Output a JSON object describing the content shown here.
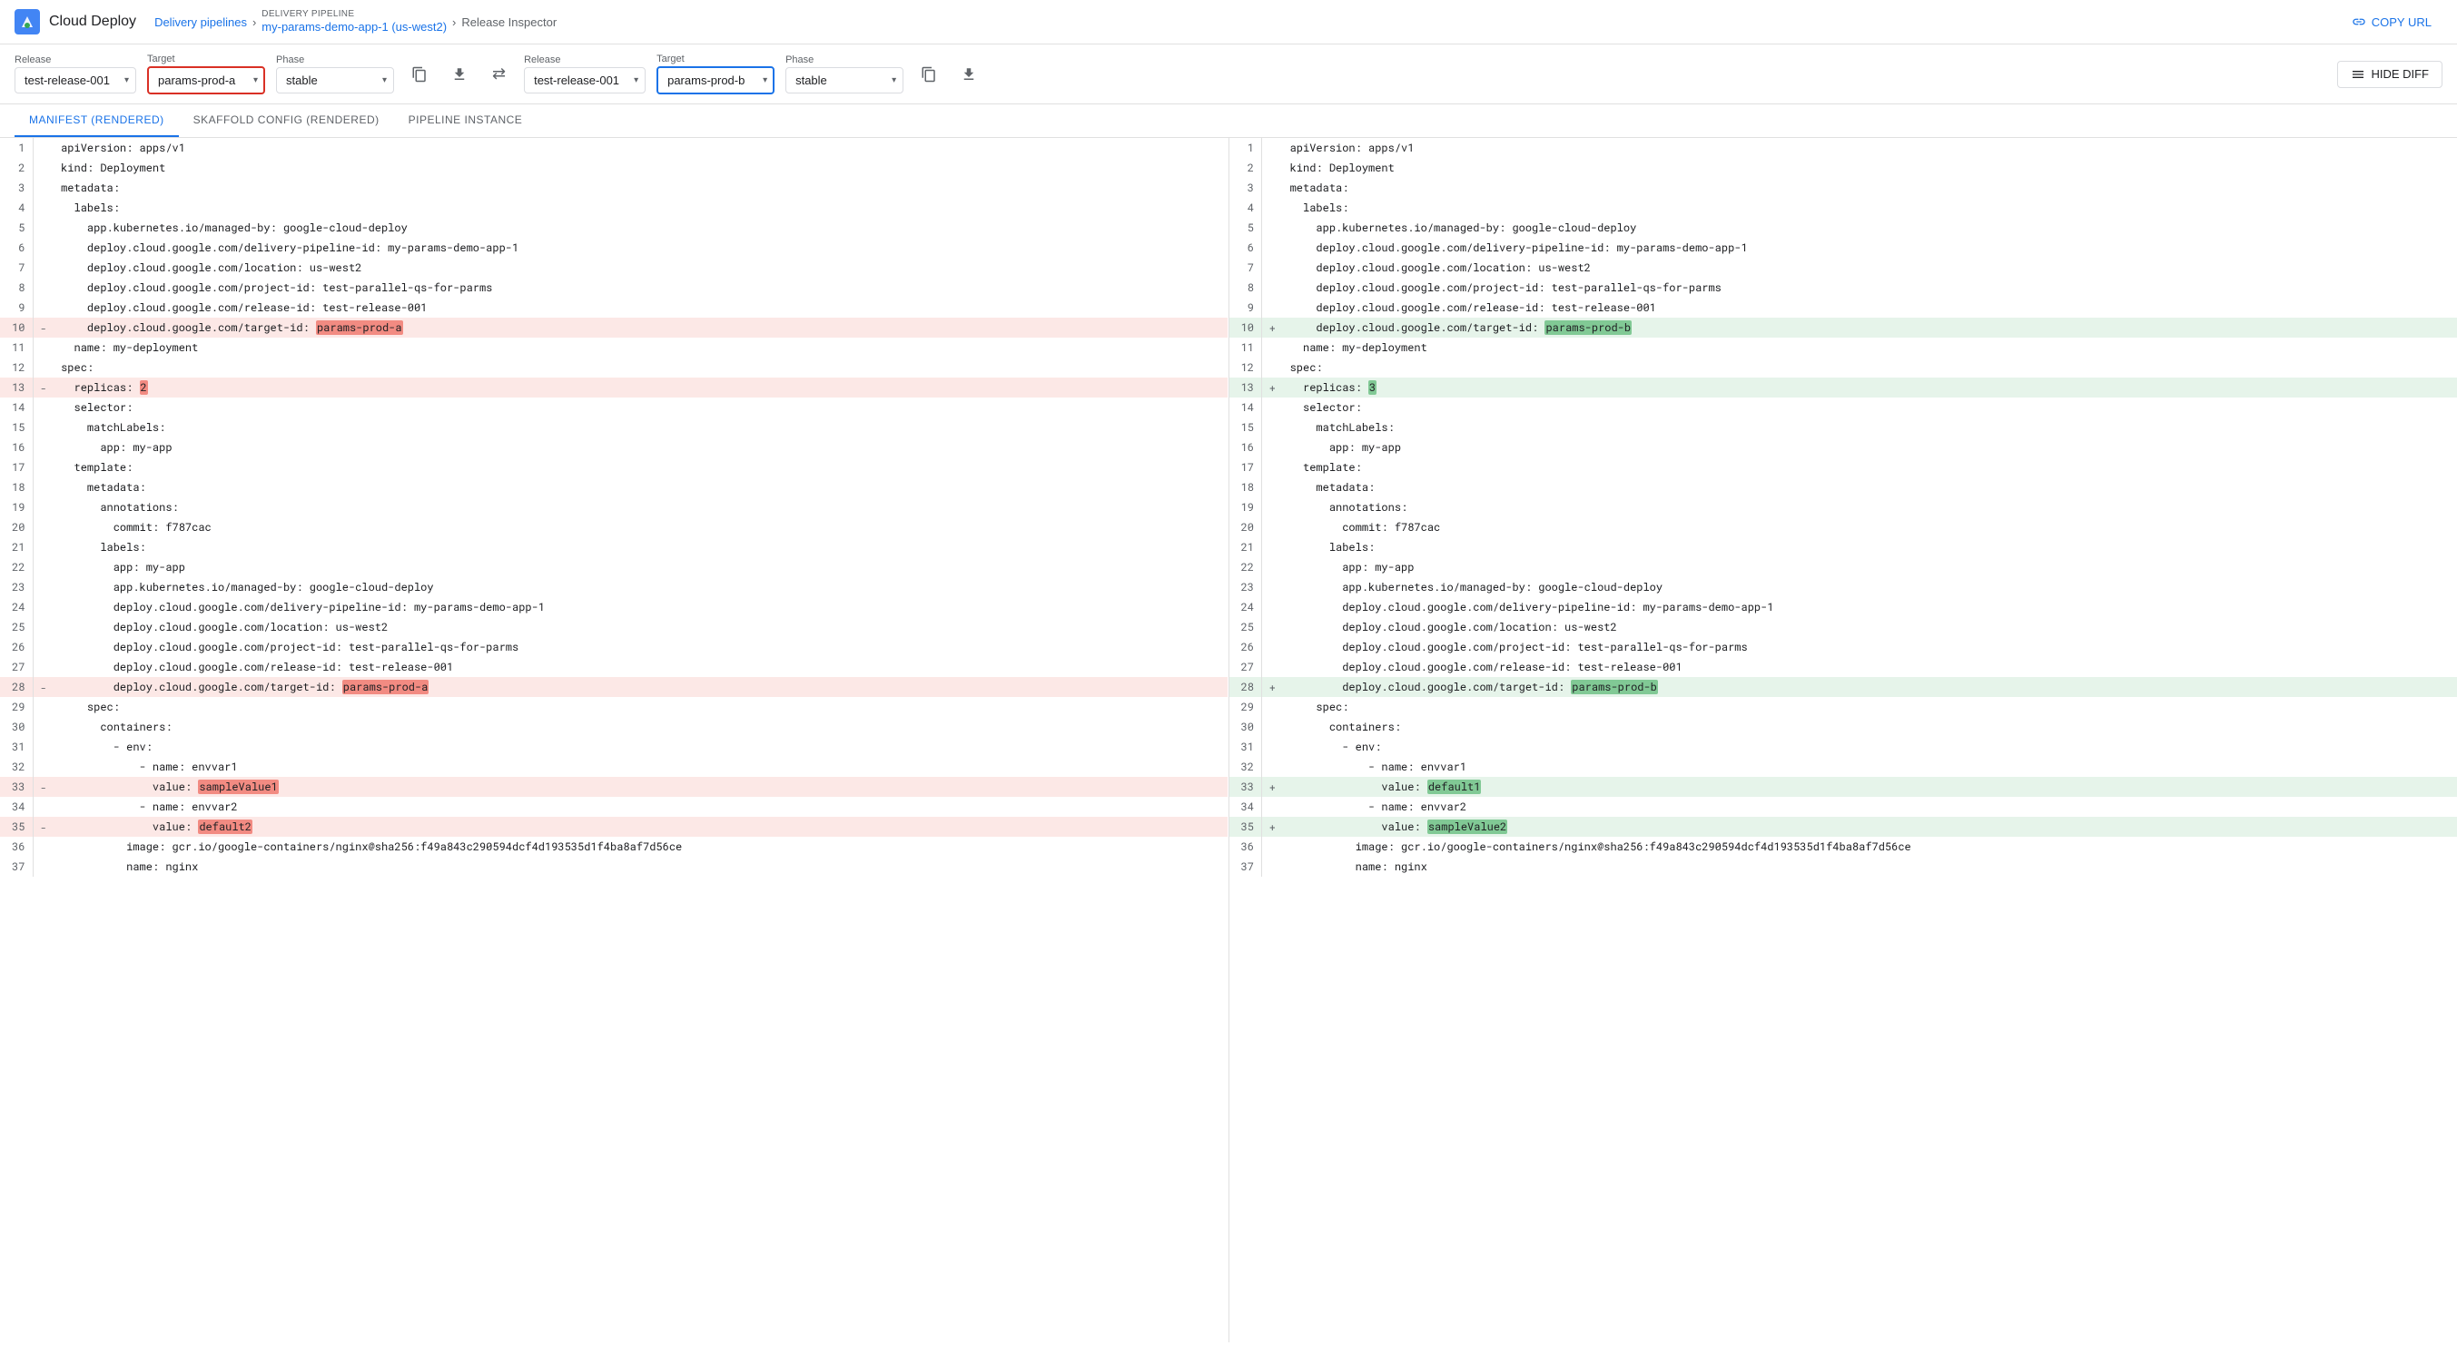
{
  "header": {
    "logo_text": "Cloud Deploy",
    "breadcrumb": {
      "delivery_pipelines_label": "Delivery pipelines",
      "delivery_pipeline_label": "DELIVERY PIPELINE",
      "pipeline_name": "my-params-demo-app-1 (us-west2)",
      "release_inspector": "Release Inspector"
    },
    "copy_url_label": "COPY URL"
  },
  "controls_left": {
    "release_label": "Release",
    "release_value": "test-release-001",
    "target_label": "Target",
    "target_value": "params-prod-a",
    "phase_label": "Phase",
    "phase_value": "stable"
  },
  "controls_right": {
    "release_label": "Release",
    "release_value": "test-release-001",
    "target_label": "Target",
    "target_value": "params-prod-b",
    "phase_label": "Phase",
    "phase_value": "stable",
    "hide_diff_label": "HIDE DIFF"
  },
  "tabs": [
    {
      "id": "manifest",
      "label": "MANIFEST (RENDERED)",
      "active": true
    },
    {
      "id": "skaffold",
      "label": "SKAFFOLD CONFIG (RENDERED)",
      "active": false
    },
    {
      "id": "pipeline",
      "label": "PIPELINE INSTANCE",
      "active": false
    }
  ],
  "left_code": [
    {
      "num": 1,
      "diff": "",
      "code": "apiVersion: apps/v1",
      "type": "normal"
    },
    {
      "num": 2,
      "diff": "",
      "code": "kind: Deployment",
      "type": "normal"
    },
    {
      "num": 3,
      "diff": "",
      "code": "metadata:",
      "type": "normal"
    },
    {
      "num": 4,
      "diff": "",
      "code": "  labels:",
      "type": "normal"
    },
    {
      "num": 5,
      "diff": "",
      "code": "    app.kubernetes.io/managed-by: google-cloud-deploy",
      "type": "normal"
    },
    {
      "num": 6,
      "diff": "",
      "code": "    deploy.cloud.google.com/delivery-pipeline-id: my-params-demo-app-1",
      "type": "normal"
    },
    {
      "num": 7,
      "diff": "",
      "code": "    deploy.cloud.google.com/location: us-west2",
      "type": "normal"
    },
    {
      "num": 8,
      "diff": "",
      "code": "    deploy.cloud.google.com/project-id: test-parallel-qs-for-parms",
      "type": "normal"
    },
    {
      "num": 9,
      "diff": "",
      "code": "    deploy.cloud.google.com/release-id: test-release-001",
      "type": "normal"
    },
    {
      "num": 10,
      "diff": "-",
      "code": "    deploy.cloud.google.com/target-id: params-prod-a",
      "type": "removed",
      "highlight_start": 46,
      "highlight_text": "params-prod-a"
    },
    {
      "num": 11,
      "diff": "",
      "code": "  name: my-deployment",
      "type": "normal"
    },
    {
      "num": 12,
      "diff": "",
      "code": "spec:",
      "type": "normal"
    },
    {
      "num": 13,
      "diff": "-",
      "code": "  replicas: 2",
      "type": "removed",
      "highlight_start": 11,
      "highlight_text": "2"
    },
    {
      "num": 14,
      "diff": "",
      "code": "  selector:",
      "type": "normal"
    },
    {
      "num": 15,
      "diff": "",
      "code": "    matchLabels:",
      "type": "normal"
    },
    {
      "num": 16,
      "diff": "",
      "code": "      app: my-app",
      "type": "normal"
    },
    {
      "num": 17,
      "diff": "",
      "code": "  template:",
      "type": "normal"
    },
    {
      "num": 18,
      "diff": "",
      "code": "    metadata:",
      "type": "normal"
    },
    {
      "num": 19,
      "diff": "",
      "code": "      annotations:",
      "type": "normal"
    },
    {
      "num": 20,
      "diff": "",
      "code": "        commit: f787cac",
      "type": "normal"
    },
    {
      "num": 21,
      "diff": "",
      "code": "      labels:",
      "type": "normal"
    },
    {
      "num": 22,
      "diff": "",
      "code": "        app: my-app",
      "type": "normal"
    },
    {
      "num": 23,
      "diff": "",
      "code": "        app.kubernetes.io/managed-by: google-cloud-deploy",
      "type": "normal"
    },
    {
      "num": 24,
      "diff": "",
      "code": "        deploy.cloud.google.com/delivery-pipeline-id: my-params-demo-app-1",
      "type": "normal"
    },
    {
      "num": 25,
      "diff": "",
      "code": "        deploy.cloud.google.com/location: us-west2",
      "type": "normal"
    },
    {
      "num": 26,
      "diff": "",
      "code": "        deploy.cloud.google.com/project-id: test-parallel-qs-for-parms",
      "type": "normal"
    },
    {
      "num": 27,
      "diff": "",
      "code": "        deploy.cloud.google.com/release-id: test-release-001",
      "type": "normal"
    },
    {
      "num": 28,
      "diff": "-",
      "code": "        deploy.cloud.google.com/target-id: params-prod-a",
      "type": "removed",
      "highlight_text": "params-prod-a"
    },
    {
      "num": 29,
      "diff": "",
      "code": "    spec:",
      "type": "normal"
    },
    {
      "num": 30,
      "diff": "",
      "code": "      containers:",
      "type": "normal"
    },
    {
      "num": 31,
      "diff": "",
      "code": "        - env:",
      "type": "normal"
    },
    {
      "num": 32,
      "diff": "",
      "code": "            - name: envvar1",
      "type": "normal"
    },
    {
      "num": 33,
      "diff": "-",
      "code": "              value: sampleValue1",
      "type": "removed",
      "highlight_text": "sampleValue1"
    },
    {
      "num": 34,
      "diff": "",
      "code": "            - name: envvar2",
      "type": "normal"
    },
    {
      "num": 35,
      "diff": "-",
      "code": "              value: default2",
      "type": "removed",
      "highlight_text": "default2"
    },
    {
      "num": 36,
      "diff": "",
      "code": "          image: gcr.io/google-containers/nginx@sha256:f49a843c290594dcf4d193535d1f4ba8af7d56ce",
      "type": "normal"
    },
    {
      "num": 37,
      "diff": "",
      "code": "          name: nginx",
      "type": "normal"
    }
  ],
  "right_code": [
    {
      "num": 1,
      "diff": "",
      "code": "apiVersion: apps/v1",
      "type": "normal"
    },
    {
      "num": 2,
      "diff": "",
      "code": "kind: Deployment",
      "type": "normal"
    },
    {
      "num": 3,
      "diff": "",
      "code": "metadata:",
      "type": "normal"
    },
    {
      "num": 4,
      "diff": "",
      "code": "  labels:",
      "type": "normal"
    },
    {
      "num": 5,
      "diff": "",
      "code": "    app.kubernetes.io/managed-by: google-cloud-deploy",
      "type": "normal"
    },
    {
      "num": 6,
      "diff": "",
      "code": "    deploy.cloud.google.com/delivery-pipeline-id: my-params-demo-app-1",
      "type": "normal"
    },
    {
      "num": 7,
      "diff": "",
      "code": "    deploy.cloud.google.com/location: us-west2",
      "type": "normal"
    },
    {
      "num": 8,
      "diff": "",
      "code": "    deploy.cloud.google.com/project-id: test-parallel-qs-for-parms",
      "type": "normal"
    },
    {
      "num": 9,
      "diff": "",
      "code": "    deploy.cloud.google.com/release-id: test-release-001",
      "type": "normal"
    },
    {
      "num": 10,
      "diff": "+",
      "code": "    deploy.cloud.google.com/target-id: params-prod-b",
      "type": "added",
      "highlight_text": "params-prod-b"
    },
    {
      "num": 11,
      "diff": "",
      "code": "  name: my-deployment",
      "type": "normal"
    },
    {
      "num": 12,
      "diff": "",
      "code": "spec:",
      "type": "normal"
    },
    {
      "num": 13,
      "diff": "+",
      "code": "  replicas: 3",
      "type": "added",
      "highlight_text": "3"
    },
    {
      "num": 14,
      "diff": "",
      "code": "  selector:",
      "type": "normal"
    },
    {
      "num": 15,
      "diff": "",
      "code": "    matchLabels:",
      "type": "normal"
    },
    {
      "num": 16,
      "diff": "",
      "code": "      app: my-app",
      "type": "normal"
    },
    {
      "num": 17,
      "diff": "",
      "code": "  template:",
      "type": "normal"
    },
    {
      "num": 18,
      "diff": "",
      "code": "    metadata:",
      "type": "normal"
    },
    {
      "num": 19,
      "diff": "",
      "code": "      annotations:",
      "type": "normal"
    },
    {
      "num": 20,
      "diff": "",
      "code": "        commit: f787cac",
      "type": "normal"
    },
    {
      "num": 21,
      "diff": "",
      "code": "      labels:",
      "type": "normal"
    },
    {
      "num": 22,
      "diff": "",
      "code": "        app: my-app",
      "type": "normal"
    },
    {
      "num": 23,
      "diff": "",
      "code": "        app.kubernetes.io/managed-by: google-cloud-deploy",
      "type": "normal"
    },
    {
      "num": 24,
      "diff": "",
      "code": "        deploy.cloud.google.com/delivery-pipeline-id: my-params-demo-app-1",
      "type": "normal"
    },
    {
      "num": 25,
      "diff": "",
      "code": "        deploy.cloud.google.com/location: us-west2",
      "type": "normal"
    },
    {
      "num": 26,
      "diff": "",
      "code": "        deploy.cloud.google.com/project-id: test-parallel-qs-for-parms",
      "type": "normal"
    },
    {
      "num": 27,
      "diff": "",
      "code": "        deploy.cloud.google.com/release-id: test-release-001",
      "type": "normal"
    },
    {
      "num": 28,
      "diff": "+",
      "code": "        deploy.cloud.google.com/target-id: params-prod-b",
      "type": "added",
      "highlight_text": "params-prod-b"
    },
    {
      "num": 29,
      "diff": "",
      "code": "    spec:",
      "type": "normal"
    },
    {
      "num": 30,
      "diff": "",
      "code": "      containers:",
      "type": "normal"
    },
    {
      "num": 31,
      "diff": "",
      "code": "        - env:",
      "type": "normal"
    },
    {
      "num": 32,
      "diff": "",
      "code": "            - name: envvar1",
      "type": "normal"
    },
    {
      "num": 33,
      "diff": "+",
      "code": "              value: default1",
      "type": "added",
      "highlight_text": "default1"
    },
    {
      "num": 34,
      "diff": "",
      "code": "            - name: envvar2",
      "type": "normal"
    },
    {
      "num": 35,
      "diff": "+",
      "code": "              value: sampleValue2",
      "type": "added",
      "highlight_text": "sampleValue2"
    },
    {
      "num": 36,
      "diff": "",
      "code": "          image: gcr.io/google-containers/nginx@sha256:f49a843c290594dcf4d193535d1f4ba8af7d56ce",
      "type": "normal"
    },
    {
      "num": 37,
      "diff": "",
      "code": "          name: nginx",
      "type": "normal"
    }
  ]
}
